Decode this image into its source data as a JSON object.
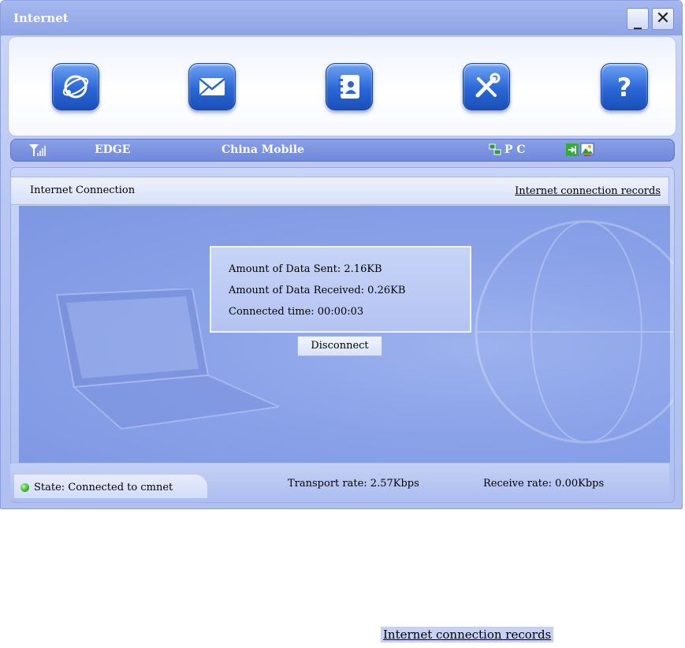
{
  "window": {
    "title": "Internet",
    "minimize_label": "_",
    "close_label": "✕"
  },
  "toolbar": {
    "buttons": [
      {
        "name": "internet",
        "icon": "globe-icon"
      },
      {
        "name": "sms",
        "icon": "envelope-icon"
      },
      {
        "name": "phonebook",
        "icon": "contacts-book-icon"
      },
      {
        "name": "settings",
        "icon": "tools-icon"
      },
      {
        "name": "help",
        "icon": "question-icon"
      }
    ]
  },
  "status": {
    "network_type": "EDGE",
    "operator": "China Mobile",
    "pc_label": "P C",
    "signal_icon": "signal-icon"
  },
  "connection": {
    "tab_label": "Internet Connection",
    "records_link": "Internet connection records",
    "data_sent": "Amount of Data Sent: 2.16KB",
    "data_received": "Amount of Data Received: 0.26KB",
    "connected_time": "Connected time: 00:00:03",
    "disconnect_label": "Disconnect"
  },
  "footer": {
    "state": "State: Connected to cmnet",
    "transport_rate": "Transport rate: 2.57Kbps",
    "receive_rate": "Receive rate: 0.00Kbps"
  },
  "zoom": {
    "records_link": "Internet connection records"
  },
  "colors": {
    "accent": "#2a67d6",
    "status_bar": "#7b92e0",
    "connected": "#3cb422"
  }
}
